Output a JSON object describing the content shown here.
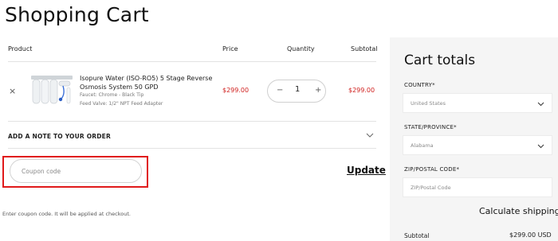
{
  "page": {
    "title": "Shopping Cart"
  },
  "cart_table": {
    "headers": {
      "product": "Product",
      "price": "Price",
      "quantity": "Quantity",
      "subtotal": "Subtotal"
    },
    "items": [
      {
        "remove_icon": "×",
        "name": "Isopure Water (ISO-RO5) 5 Stage Reverse Osmosis System 50 GPD",
        "meta_1": "Faucet: Chrome - Black Tip",
        "meta_2": "Feed Valve: 1/2\" NPT Feed Adapter",
        "price": "$299.00",
        "quantity": "1",
        "minus": "−",
        "plus": "+",
        "subtotal": "$299.00"
      }
    ]
  },
  "note": {
    "label": "ADD A NOTE TO YOUR ORDER",
    "icon": "chevron-down-icon"
  },
  "coupon": {
    "placeholder": "Coupon code",
    "help": "Enter coupon code. It will be applied at checkout.",
    "update_label": "Update",
    "highlight_color": "#e0191a"
  },
  "cart_totals": {
    "title": "Cart totals",
    "country": {
      "label": "COUNTRY*",
      "value": "United States"
    },
    "state": {
      "label": "STATE/PROVINCE*",
      "value": "Alabama"
    },
    "zip": {
      "label": "ZIP/POSTAL CODE*",
      "placeholder": "ZIP/Postal Code"
    },
    "calculate_label": "Calculate shipping",
    "subtotal_label": "Subtotal",
    "subtotal_value": "$299.00 USD"
  },
  "colors": {
    "price": "#d0201e",
    "panel_bg": "#f5f5f5"
  }
}
